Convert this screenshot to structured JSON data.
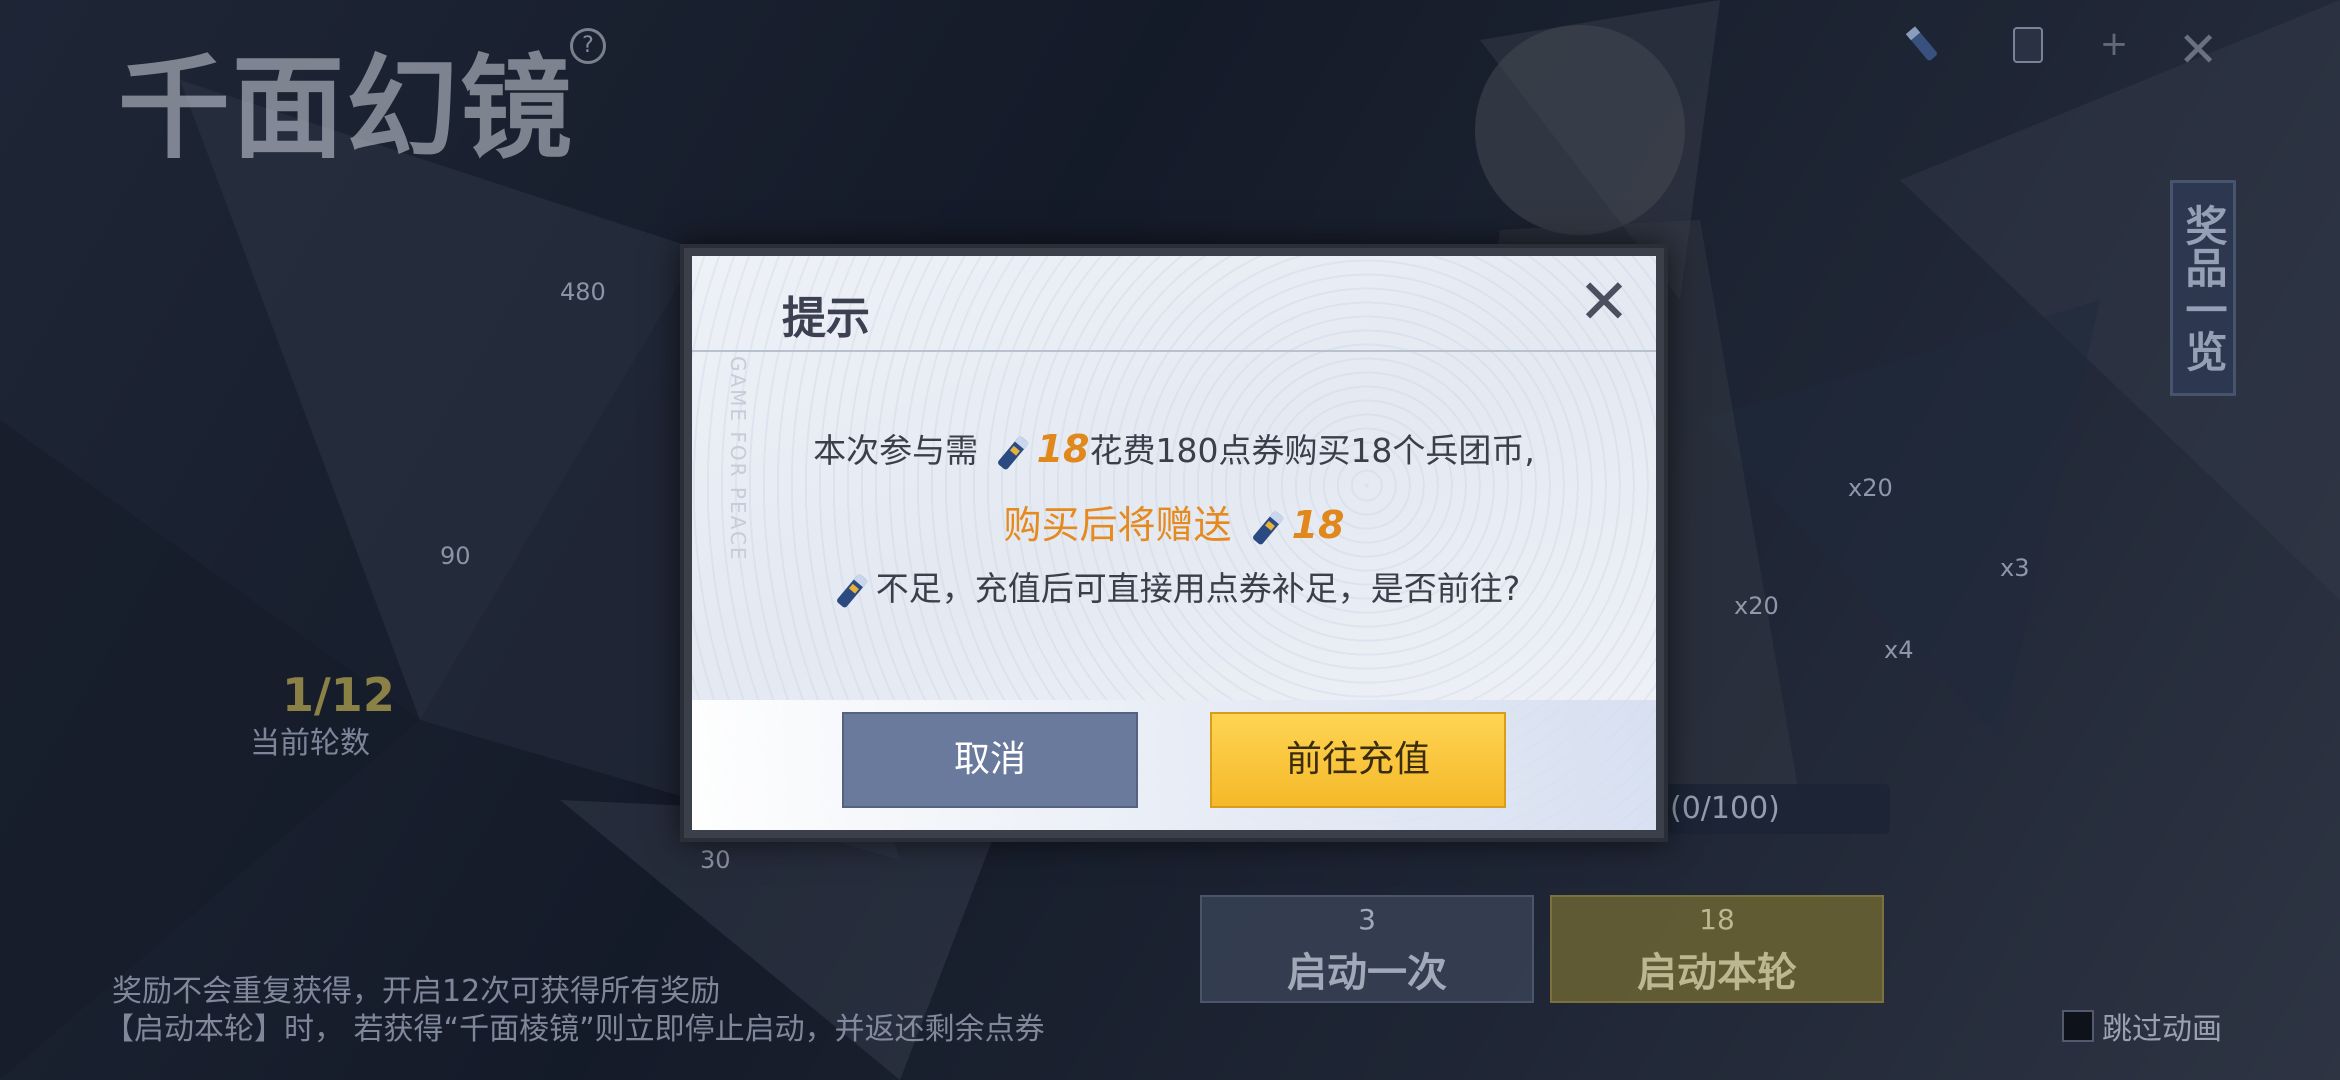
{
  "game": {
    "title": "千面幻镜",
    "help_icon": "?"
  },
  "resources": [
    {
      "icon": "token-icon",
      "value": ""
    },
    {
      "icon": "card-icon",
      "value": ""
    }
  ],
  "prize_tab": {
    "label": "奖品一览"
  },
  "costs": {
    "a": "480",
    "b": "90",
    "c": "30"
  },
  "round": {
    "value": "1/12",
    "label": "当前轮数"
  },
  "quantities": {
    "q1": "x20",
    "q2": "x3",
    "q3": "x20",
    "q4": "x4"
  },
  "progress": {
    "text": "(0/100)"
  },
  "buttons": {
    "start_once": {
      "cost": "3",
      "label": "启动一次"
    },
    "start_round": {
      "cost": "18",
      "label": "启动本轮"
    }
  },
  "rules": {
    "line1": "奖励不会重复获得，开启12次可获得所有奖励",
    "line2": "【启动本轮】时， 若获得“千面棱镜”则立即停止启动，并返还剩余点券"
  },
  "skip": {
    "label": "跳过动画"
  },
  "dialog": {
    "title": "提示",
    "watermark": "GAME FOR PEACE",
    "line1_pre": "本次参与需",
    "line1_num": "18",
    "line1_post": "花费180点券购买18个兵团币,",
    "line2_pre": "购买后将赠送",
    "line2_num": "18",
    "line3": "不足，充值后可直接用点券补足，是否前往?",
    "cancel": "取消",
    "confirm": "前往充值"
  },
  "colors": {
    "accent_orange": "#e58a1f",
    "confirm_yellow": "#f5b92a",
    "cancel_blue": "#6a7a9c"
  }
}
